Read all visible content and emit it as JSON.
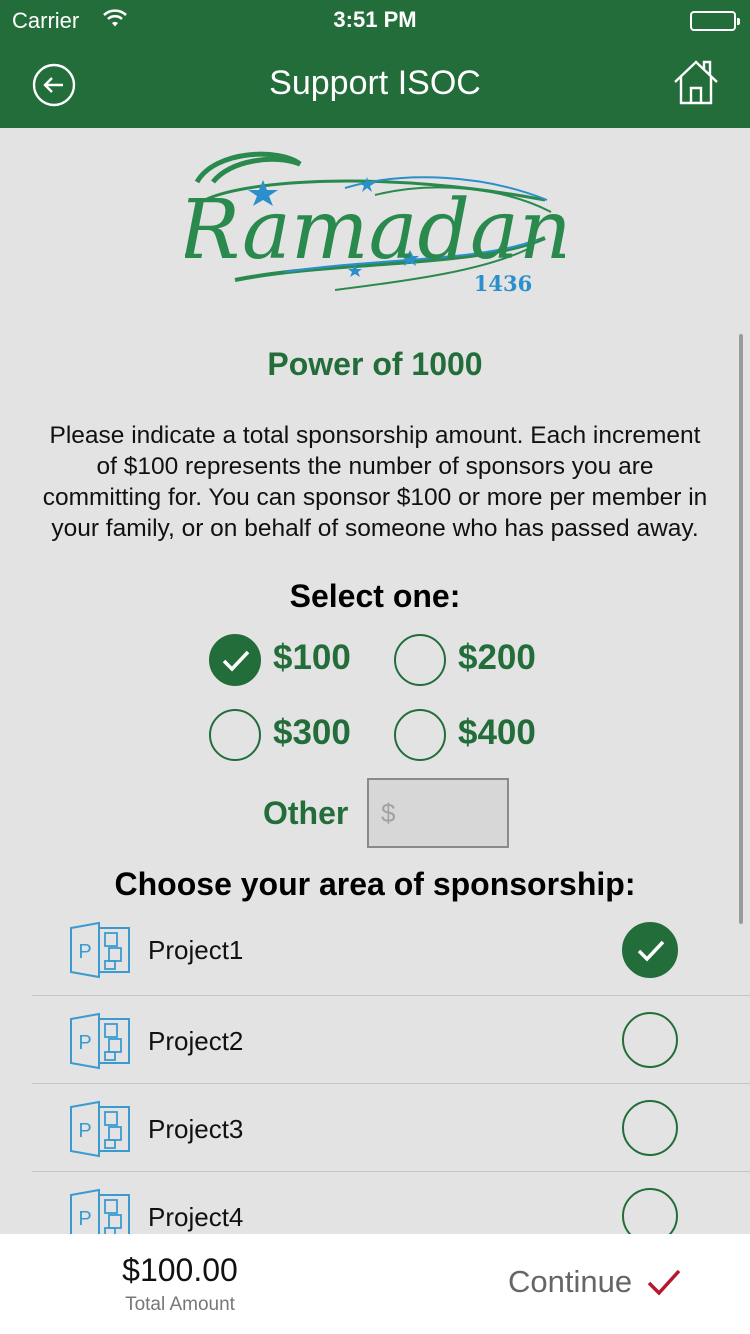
{
  "status_bar": {
    "carrier": "Carrier",
    "time": "3:51 PM"
  },
  "nav": {
    "title": "Support ISOC",
    "back_icon": "back-arrow-icon",
    "home_icon": "home-icon"
  },
  "logo": {
    "word": "Ramadan",
    "year": "1436",
    "colors": {
      "green": "#2a8a4e",
      "blue": "#2b8fcc"
    }
  },
  "section_title": "Power of 1000",
  "description": [
    "Please indicate a total sponsorship amount. Each increment",
    "of $100 represents the number of sponsors you are",
    "committing for. You can sponsor $100 or more per member in",
    "your family, or on behalf of someone who has passed away."
  ],
  "select_label": "Select one:",
  "amount_options": [
    {
      "label": "$100",
      "selected": true
    },
    {
      "label": "$200",
      "selected": false
    },
    {
      "label": "$300",
      "selected": false
    },
    {
      "label": "$400",
      "selected": false
    }
  ],
  "other": {
    "label": "Other",
    "placeholder": "$",
    "value": ""
  },
  "area_label": "Choose your area of sponsorship:",
  "projects": [
    {
      "label": "Project1",
      "selected": true
    },
    {
      "label": "Project2",
      "selected": false
    },
    {
      "label": "Project3",
      "selected": false
    },
    {
      "label": "Project4",
      "selected": false
    }
  ],
  "footer": {
    "total_amount": "$100.00",
    "total_label": "Total Amount",
    "continue_label": "Continue"
  },
  "colors": {
    "primary": "#236d3a",
    "background": "#e3e3e3",
    "continue_check": "#b5192e",
    "project_icon": "#3b9bd0"
  }
}
